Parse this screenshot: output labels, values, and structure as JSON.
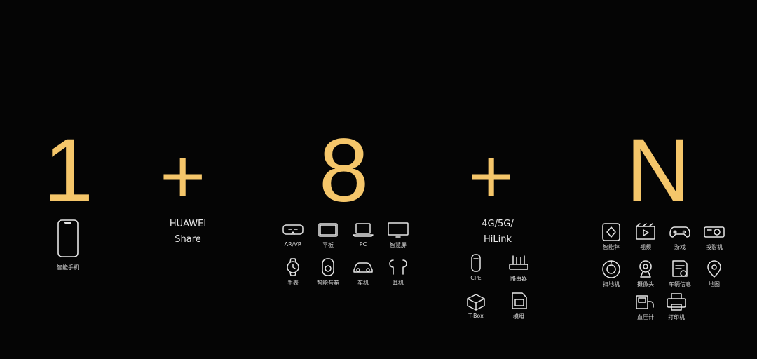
{
  "formula": {
    "one": "1",
    "plus_a": "+",
    "eight": "8",
    "plus_b": "+",
    "n": "N",
    "digit_color": "#f5c66a"
  },
  "entry": {
    "label": "智能手机",
    "icon": "smartphone-icon"
  },
  "share": {
    "line1": "HUAWEI",
    "line2": "Share"
  },
  "eight_devices": [
    {
      "label": "AR/VR",
      "icon": "vr-glasses-icon"
    },
    {
      "label": "平板",
      "icon": "tablet-icon"
    },
    {
      "label": "PC",
      "icon": "laptop-icon"
    },
    {
      "label": "智慧屏",
      "icon": "tv-icon"
    },
    {
      "label": "手表",
      "icon": "watch-icon"
    },
    {
      "label": "智能音箱",
      "icon": "speaker-icon"
    },
    {
      "label": "车机",
      "icon": "car-icon"
    },
    {
      "label": "耳机",
      "icon": "earbuds-icon"
    }
  ],
  "connect": {
    "line1": "4G/5G/",
    "line2": "HiLink"
  },
  "connect_devices": [
    {
      "label": "CPE",
      "icon": "cpe-icon"
    },
    {
      "label": "路由器",
      "icon": "router-icon"
    },
    {
      "label": "T-Box",
      "icon": "tbox-icon"
    },
    {
      "label": "模组",
      "icon": "sim-module-icon"
    }
  ],
  "n_devices": [
    {
      "label": "智能秤",
      "icon": "scale-icon"
    },
    {
      "label": "视频",
      "icon": "video-icon"
    },
    {
      "label": "游戏",
      "icon": "gamepad-icon"
    },
    {
      "label": "投影机",
      "icon": "projector-icon"
    },
    {
      "label": "扫地机",
      "icon": "robot-vacuum-icon"
    },
    {
      "label": "摄像头",
      "icon": "camera-icon"
    },
    {
      "label": "车辆信息",
      "icon": "vehicle-info-icon"
    },
    {
      "label": "地图",
      "icon": "map-pin-icon"
    },
    {
      "label": "血压计",
      "icon": "blood-pressure-icon"
    },
    {
      "label": "打印机",
      "icon": "printer-icon"
    }
  ]
}
